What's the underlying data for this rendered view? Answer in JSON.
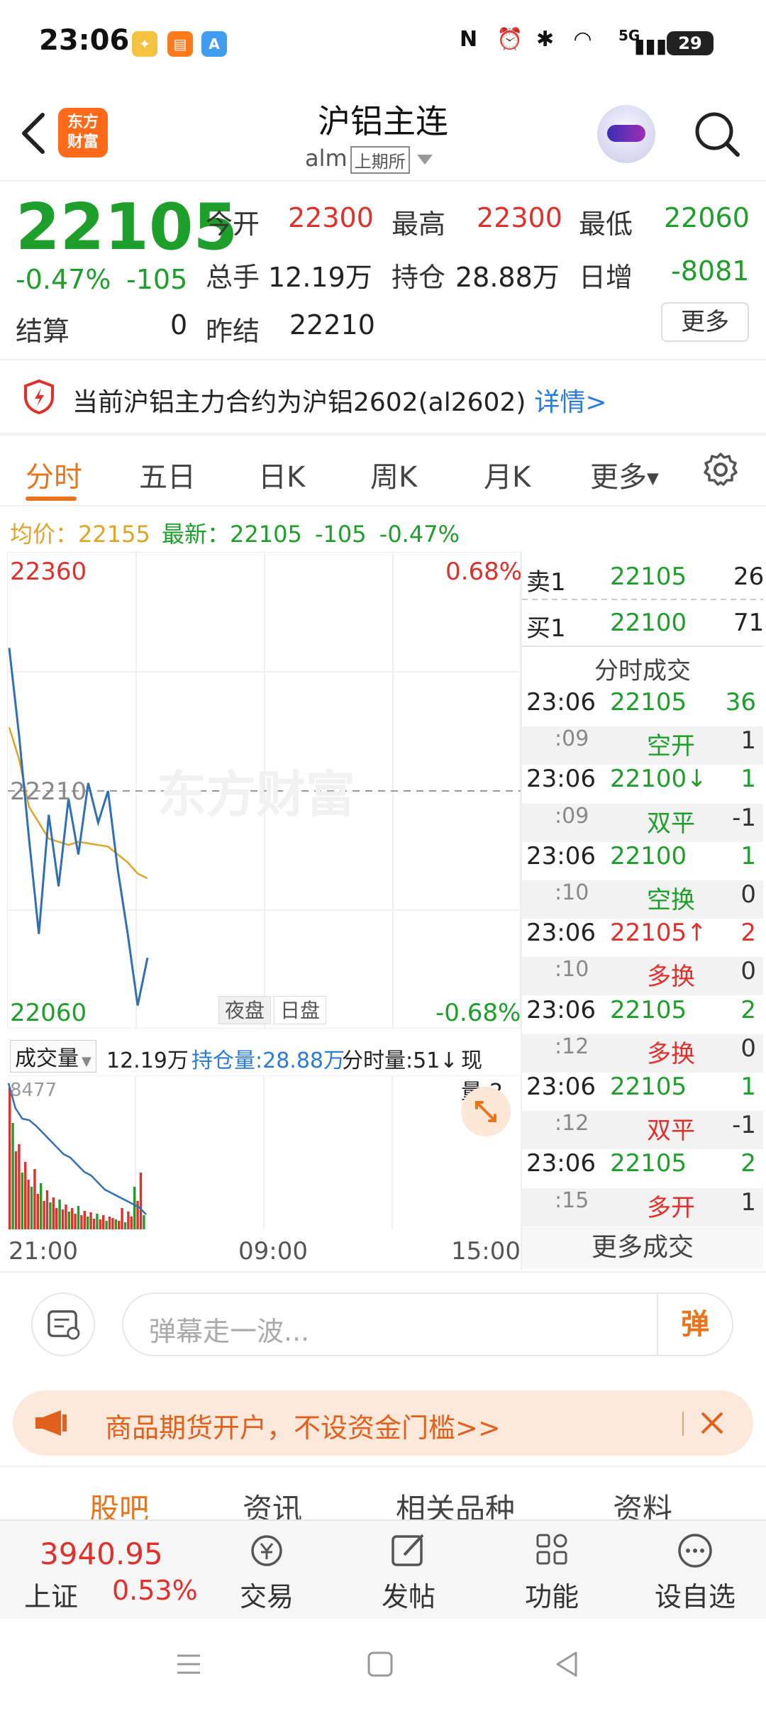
{
  "status_bar": {
    "time": "23:06",
    "network": "5G",
    "battery": "29"
  },
  "header": {
    "title": "沪铝主连",
    "code": "alm",
    "exchange": "上期所",
    "logo_text_line1": "东方",
    "logo_text_line2": "财富"
  },
  "quote": {
    "price": "22105",
    "change_pct": "-0.47%",
    "change": "-105",
    "open_label": "今开",
    "open": "22300",
    "high_label": "最高",
    "high": "22300",
    "low_label": "最低",
    "low": "22060",
    "volume_label": "总手",
    "volume": "12.19万",
    "oi_label": "持仓",
    "oi": "28.88万",
    "daily_inc_label": "日增",
    "daily_inc": "-8081",
    "settle_label": "结算",
    "settle": "0",
    "prev_settle_label": "昨结",
    "prev_settle": "22210",
    "more_label": "更多"
  },
  "notice": {
    "text": "当前沪铝主力合约为沪铝2602(al2602)",
    "link": "详情>"
  },
  "tabs": [
    "分时",
    "五日",
    "日K",
    "周K",
    "月K",
    "更多"
  ],
  "avg_line": {
    "avg_label": "均价：",
    "avg": "22155",
    "latest_label": "最新：",
    "latest": "22105",
    "chg": "-105",
    "pct": "-0.47%"
  },
  "chart": {
    "y_max": "22360",
    "y_min": "22060",
    "y_mid": "22210",
    "pct_max": "0.68%",
    "pct_min": "-0.68%",
    "watermark": "东方财富",
    "session_night": "夜盘",
    "session_day": "日盘",
    "vol_label": "成交量",
    "vol_value": "12.19万",
    "oi_text": "持仓量:28.88万",
    "tick_vol_text": "分时量:51↓",
    "cur_vol_text": "现量:2",
    "vol_max": "8477",
    "time_start": "21:00",
    "time_mid": "09:00",
    "time_end": "15:00"
  },
  "chart_data": {
    "type": "line",
    "ylim": [
      22060,
      22360
    ],
    "ref_price": 22210,
    "series": [
      {
        "values": [
          22300,
          22245,
          22180,
          22120,
          22195,
          22150,
          22205,
          22170,
          22215,
          22190,
          22210,
          22160,
          22120,
          22075,
          22105
        ]
      },
      {
        "values": [
          22250,
          22230,
          22200,
          22190,
          22180,
          22178,
          22176,
          22178,
          22177,
          22176,
          22175,
          22170,
          22165,
          22158,
          22155
        ]
      }
    ]
  },
  "order_book": {
    "sell1_label": "卖1",
    "sell1_price": "22105",
    "sell1_qty": "26",
    "buy1_label": "买1",
    "buy1_price": "22100",
    "buy1_qty": "71",
    "ticks_title": "分时成交",
    "ticks": [
      {
        "time": "23:06",
        "price": "22105",
        "qty": "36",
        "color": "green"
      },
      {
        "time": ":09",
        "type": "空开",
        "qty": "1",
        "color": "green"
      },
      {
        "time": "23:06",
        "price": "22100↓",
        "qty": "1",
        "color": "green"
      },
      {
        "time": ":09",
        "type": "双平",
        "qty": "-1",
        "color": "green"
      },
      {
        "time": "23:06",
        "price": "22100",
        "qty": "1",
        "color": "green"
      },
      {
        "time": ":10",
        "type": "空换",
        "qty": "0",
        "color": "green"
      },
      {
        "time": "23:06",
        "price": "22105↑",
        "qty": "2",
        "color": "red"
      },
      {
        "time": ":10",
        "type": "多换",
        "qty": "0",
        "color": "red"
      },
      {
        "time": "23:06",
        "price": "22105",
        "qty": "2",
        "color": "green"
      },
      {
        "time": ":12",
        "type": "多换",
        "qty": "0",
        "color": "red"
      },
      {
        "time": "23:06",
        "price": "22105",
        "qty": "1",
        "color": "green"
      },
      {
        "time": ":12",
        "type": "双平",
        "qty": "-1",
        "color": "red"
      },
      {
        "time": "23:06",
        "price": "22105",
        "qty": "2",
        "color": "green"
      },
      {
        "time": ":15",
        "type": "多开",
        "qty": "1",
        "color": "red"
      }
    ],
    "more_trades": "更多成交"
  },
  "comment": {
    "placeholder": "弹幕走一波...",
    "danmu_btn": "弹"
  },
  "banner": {
    "text": "商品期货开户，不设资金门槛>>"
  },
  "bottom_tabs": [
    "股吧",
    "资讯",
    "相关品种",
    "资料"
  ],
  "bottom_nav": {
    "index_value": "3940.95",
    "index_name": "上证",
    "index_pct": "0.53%",
    "items": [
      "交易",
      "发帖",
      "功能",
      "设自选"
    ]
  },
  "colors": {
    "up": "#e0302b",
    "down": "#1e9e2a",
    "accent": "#e8741c",
    "price_line": "#2f6fb5",
    "avg_line": "#e0a32a"
  }
}
